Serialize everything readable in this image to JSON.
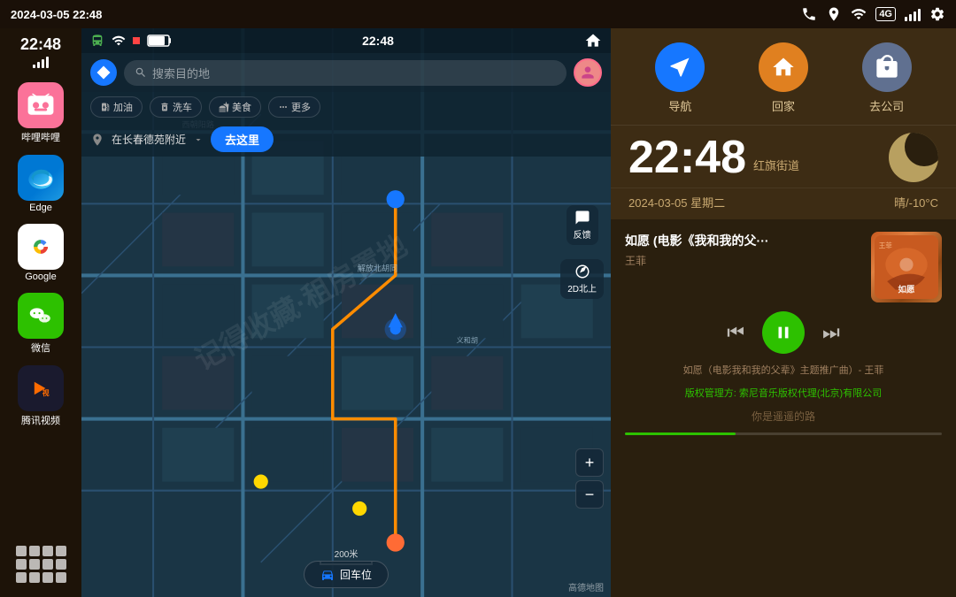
{
  "statusBar": {
    "datetime": "2024-03-05 22:48",
    "icons": [
      "phone",
      "location",
      "wifi-signal",
      "4g",
      "signal-bars",
      "settings"
    ]
  },
  "sidebar": {
    "timeWidget": {
      "time": "22:48",
      "signalLabel": "signal"
    },
    "apps": [
      {
        "id": "bilibili",
        "label": "哔哩哔哩",
        "icon": "bili",
        "color": "#fb7299"
      },
      {
        "id": "edge",
        "label": "Edge",
        "icon": "edge",
        "color": "#0078d4"
      },
      {
        "id": "google",
        "label": "Google",
        "icon": "google",
        "color": "#fff"
      },
      {
        "id": "wechat",
        "label": "微信",
        "icon": "wechat",
        "color": "#2dc100"
      },
      {
        "id": "tencentvideo",
        "label": "腾讯视频",
        "icon": "tencent",
        "color": "#1a1a2e"
      }
    ],
    "gridLabel": "apps-grid"
  },
  "map": {
    "searchPlaceholder": "搜索目的地",
    "statusTime": "22:48",
    "amenities": [
      "加油",
      "洗车",
      "美食",
      "更多"
    ],
    "locationNear": "在长春德苑附近",
    "goHereBtn": "去这里",
    "feedbackLabel": "反馈",
    "compassLabel": "2D北上",
    "returnCarLabel": "回车位",
    "scaleLabel": "200米",
    "watermark": "高德地图",
    "zoomIn": "+",
    "zoomOut": "−"
  },
  "rightPanel": {
    "navShortcuts": [
      {
        "id": "navigate",
        "label": "导航",
        "color": "#1677ff",
        "icon": "▶"
      },
      {
        "id": "home",
        "label": "回家",
        "color": "#e08020",
        "icon": "🏠"
      },
      {
        "id": "work",
        "label": "去公司",
        "color": "#607090",
        "icon": "💼"
      }
    ],
    "timeDisplay": {
      "time": "22:48",
      "location": "红旗街道"
    },
    "dateWeather": {
      "date": "2024-03-05 星期二",
      "weather": "晴/-10°C"
    },
    "musicPlayer": {
      "title": "如愿 (电影《我和我的父···",
      "artist": "王菲",
      "controls": {
        "prev": "⏮",
        "play": "⏸",
        "next": "⏭"
      },
      "subtitle": "如愿（电影我和我的父辈》主题推广曲）- 王菲",
      "copyright": "版权管理方: 索尼音乐版权代理(北京)有限公司",
      "lyric": "你是遥遥的路",
      "progress": 35
    }
  }
}
